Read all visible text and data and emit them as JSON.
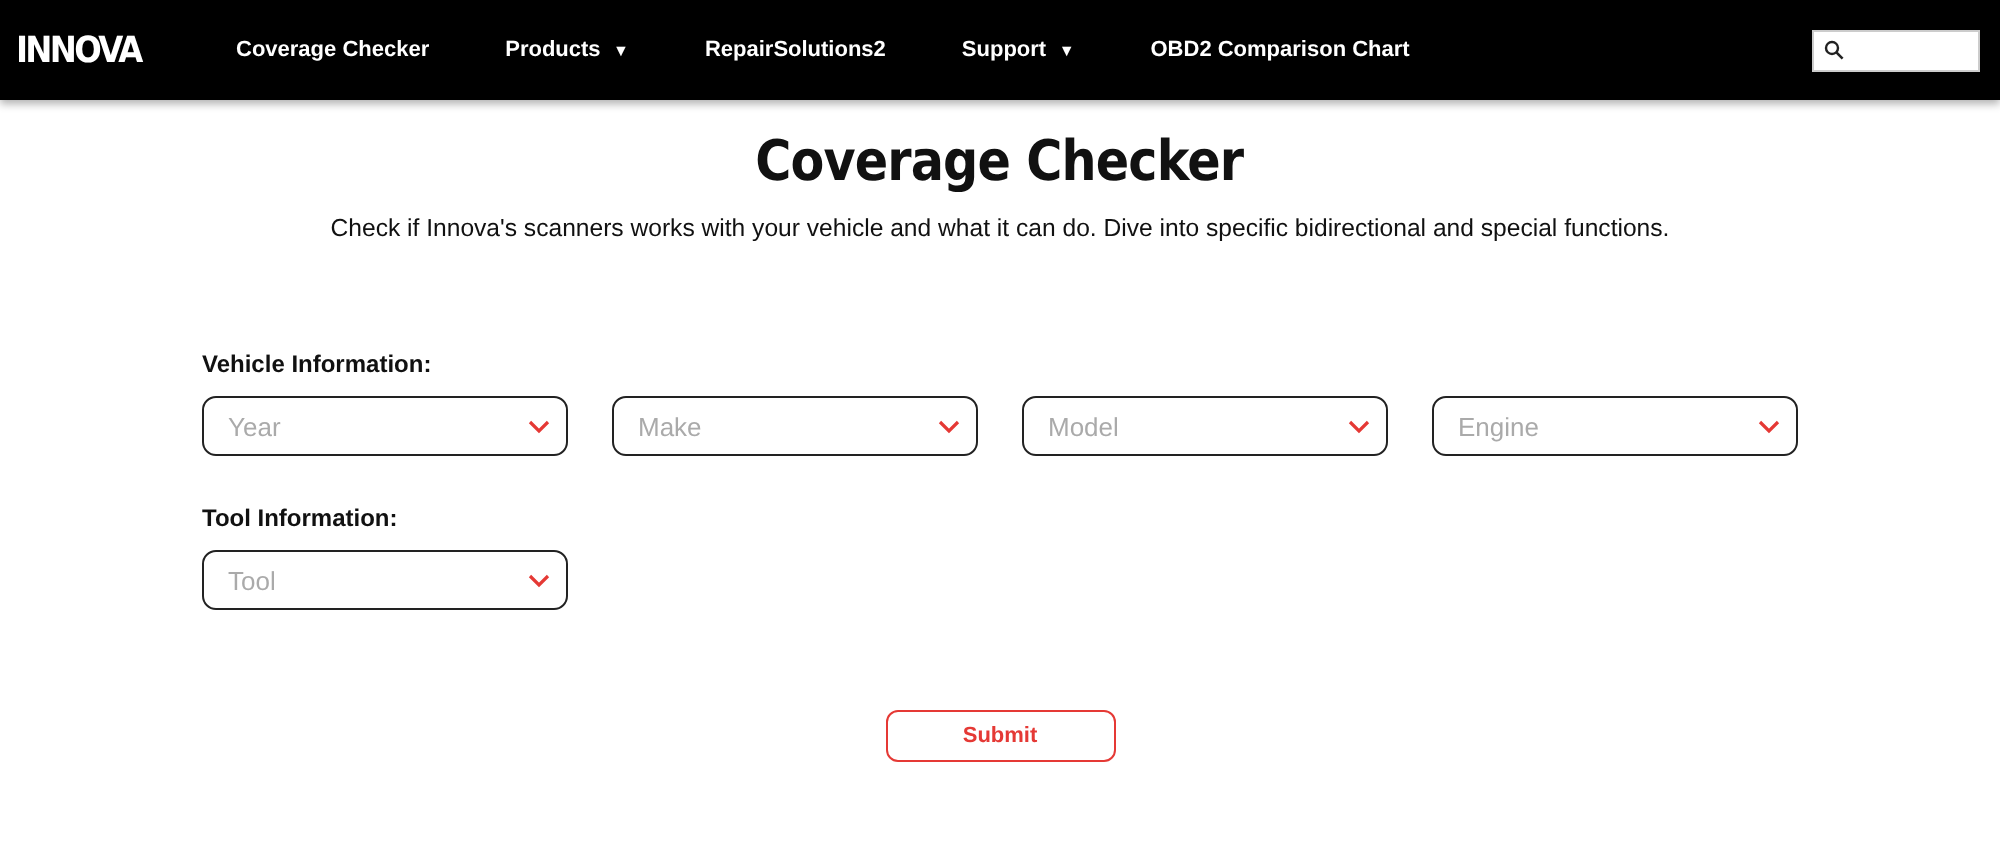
{
  "header": {
    "logo": "INNOVA",
    "nav": [
      {
        "label": "Coverage Checker"
      },
      {
        "label": "Products",
        "caret": "▼"
      },
      {
        "label": "RepairSolutions2"
      },
      {
        "label": "Support",
        "caret": "▼"
      },
      {
        "label": "OBD2 Comparison Chart"
      }
    ]
  },
  "title": "Coverage Checker",
  "subtitle": "Check if Innova's scanners works with your vehicle and what it can do. Dive into specific bidirectional and special functions.",
  "sections": [
    {
      "label": "Vehicle Information:",
      "selects": [
        {
          "placeholder": "Year"
        },
        {
          "placeholder": "Make"
        },
        {
          "placeholder": "Model"
        },
        {
          "placeholder": "Engine"
        }
      ]
    },
    {
      "label": "Tool Information:",
      "selects": [
        {
          "placeholder": "Tool"
        }
      ]
    }
  ],
  "submit": "Submit"
}
